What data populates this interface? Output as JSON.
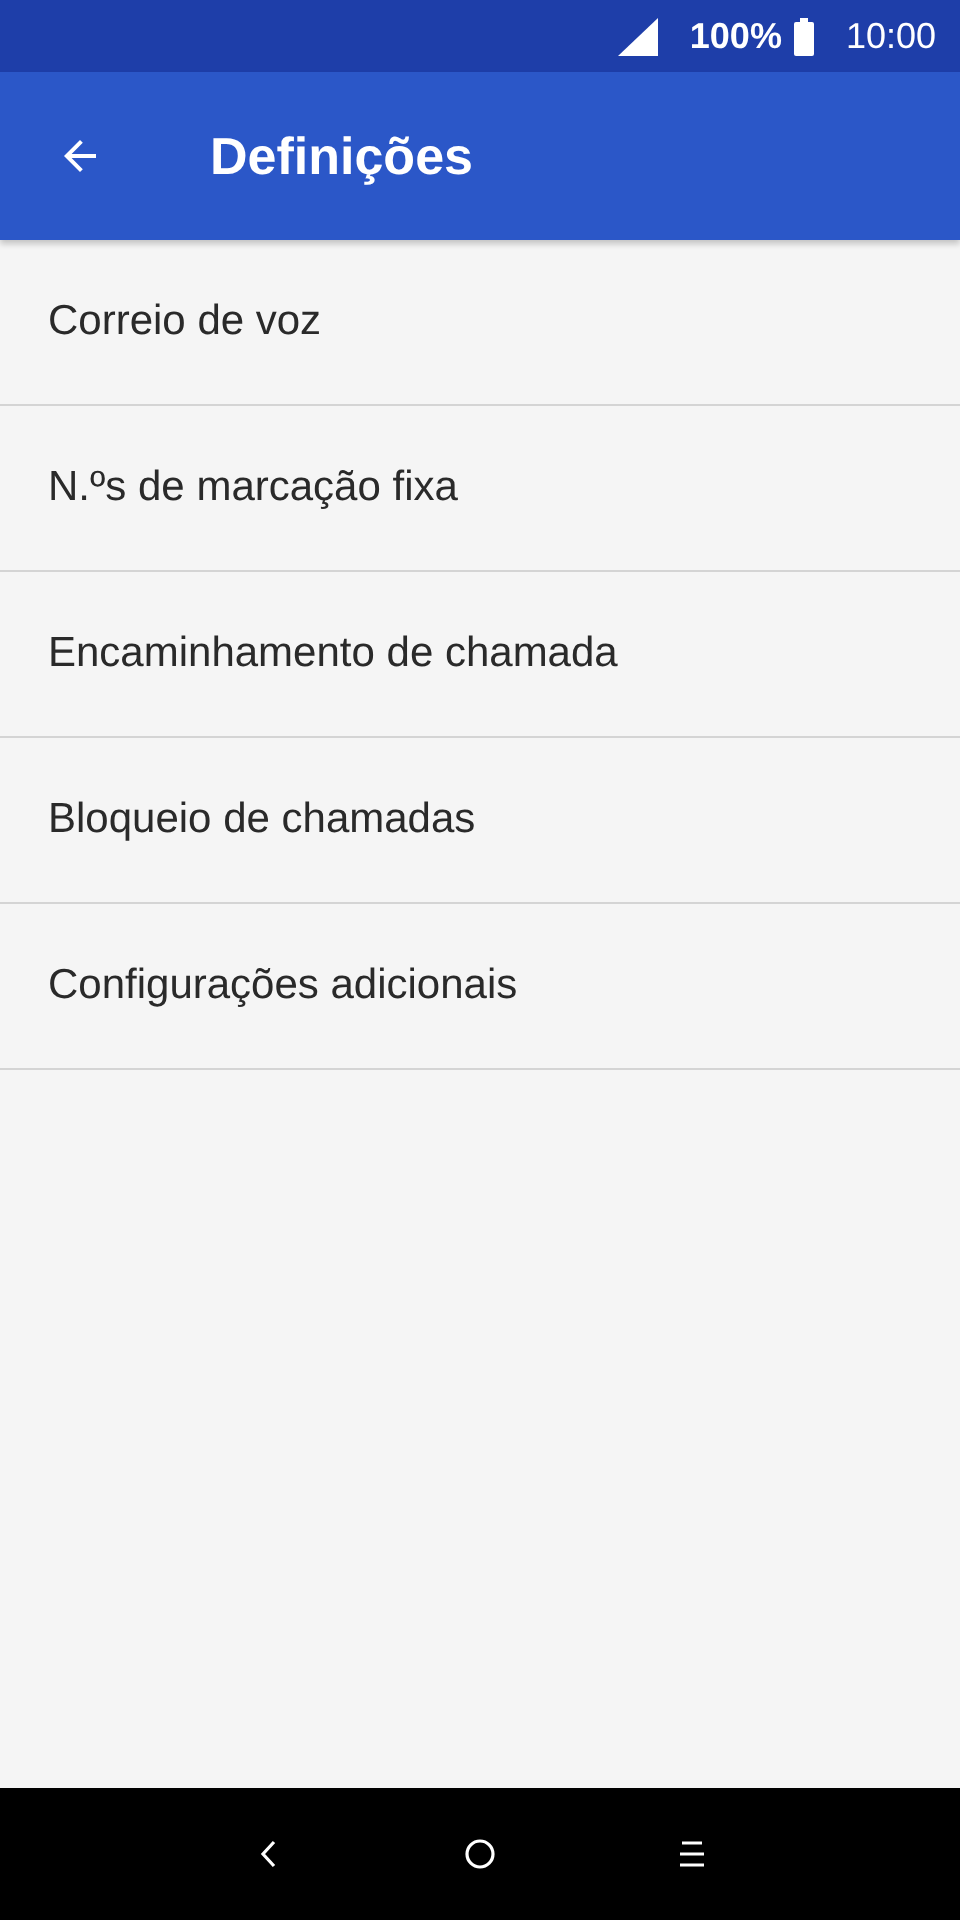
{
  "status_bar": {
    "battery": "100%",
    "time": "10:00"
  },
  "app_bar": {
    "title": "Definições"
  },
  "settings_items": [
    {
      "label": "Correio de voz"
    },
    {
      "label": "N.ºs de marcação fixa"
    },
    {
      "label": "Encaminhamento de chamada"
    },
    {
      "label": "Bloqueio de chamadas"
    },
    {
      "label": "Configurações adicionais"
    }
  ]
}
